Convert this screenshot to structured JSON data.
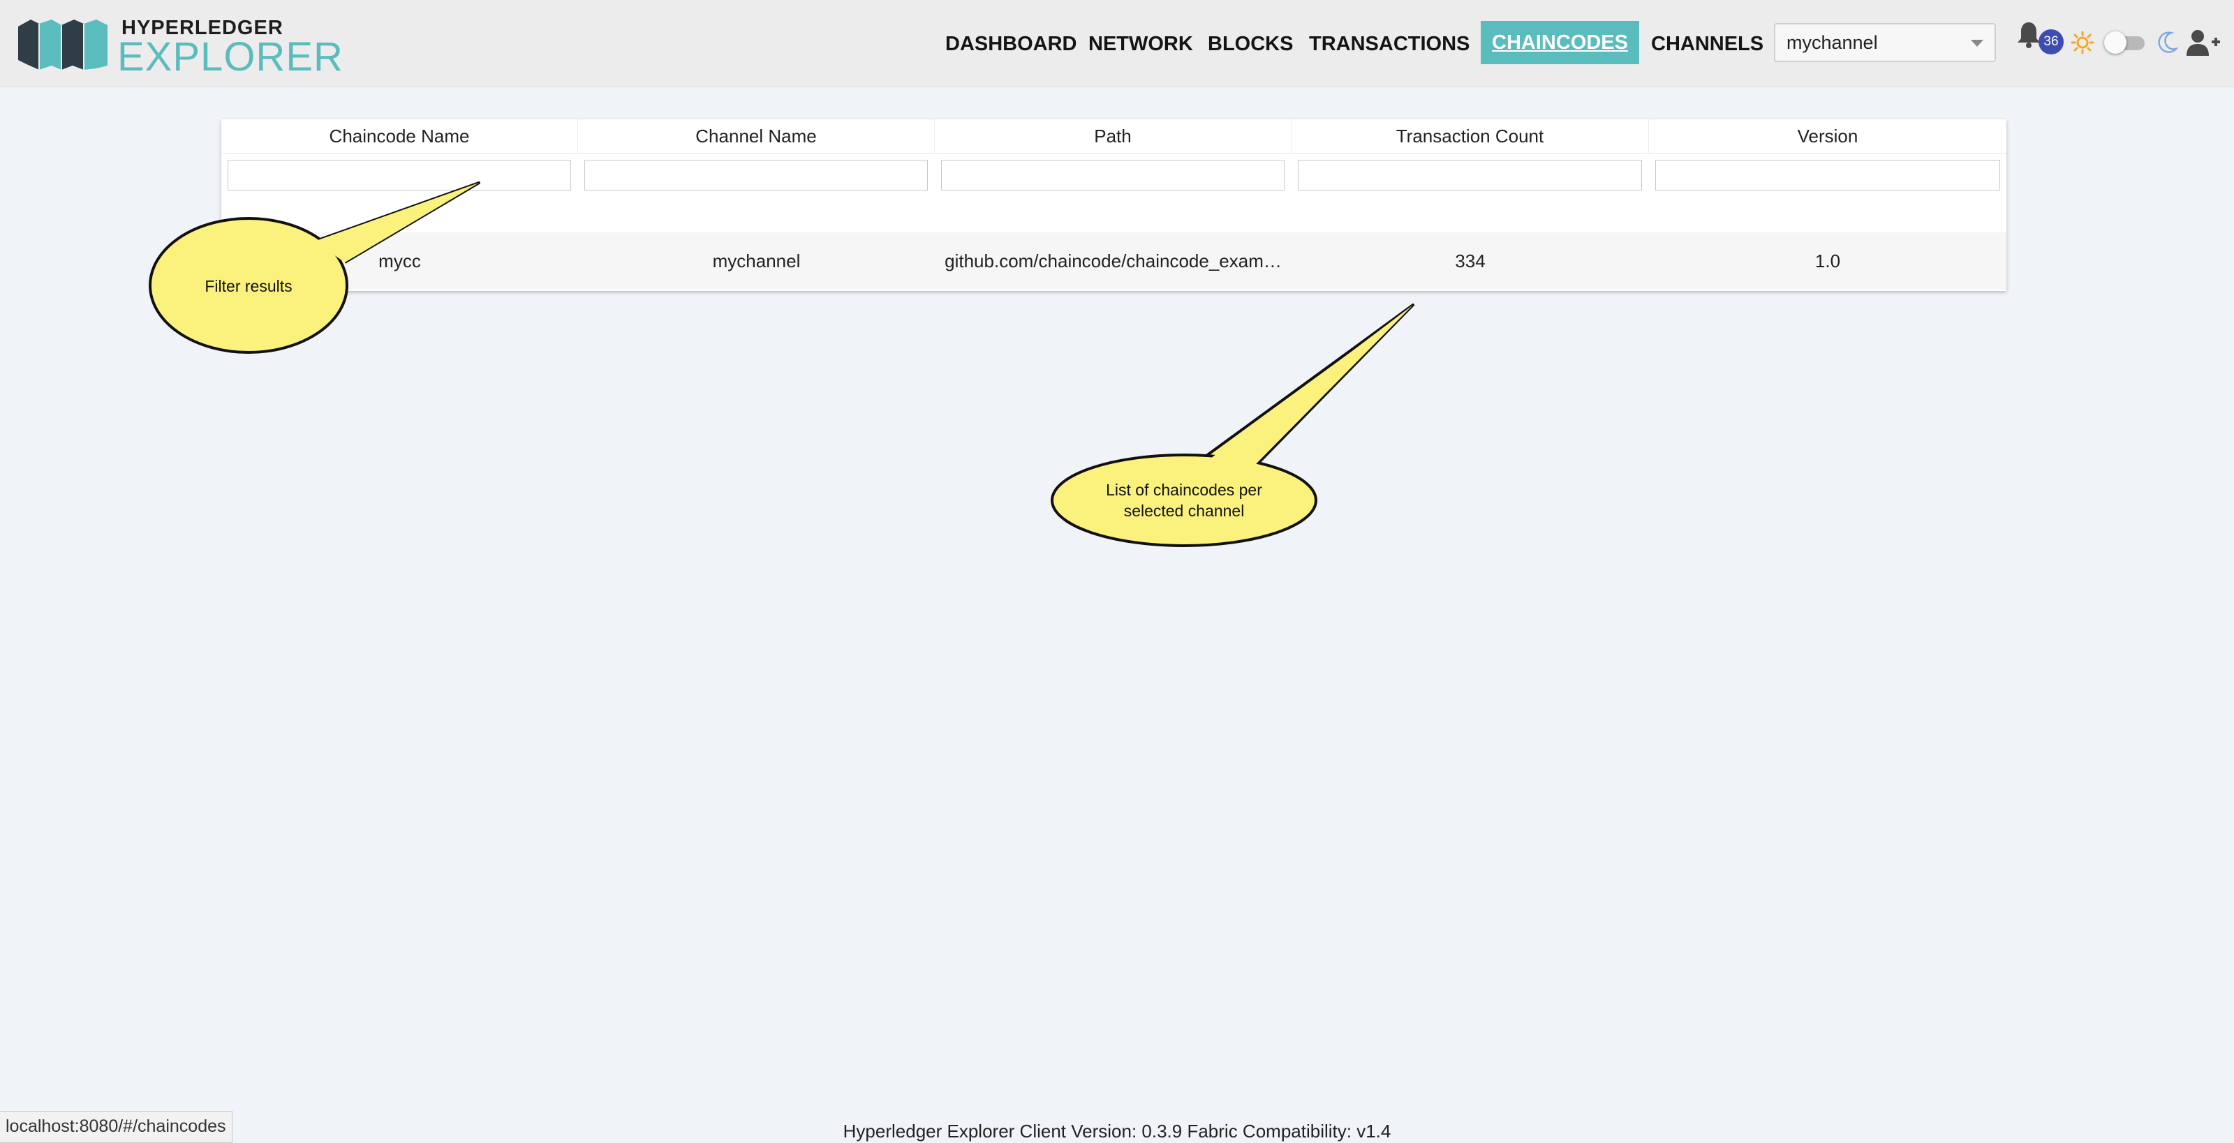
{
  "brand": {
    "top": "HYPERLEDGER",
    "bottom": "EXPLORER"
  },
  "nav": {
    "items": [
      {
        "label": "DASHBOARD"
      },
      {
        "label": "NETWORK"
      },
      {
        "label": "BLOCKS"
      },
      {
        "label": "TRANSACTIONS"
      },
      {
        "label": "CHAINCODES",
        "active": true
      },
      {
        "label": "CHANNELS"
      }
    ],
    "channel_select": {
      "value": "mychannel"
    },
    "notifications_count": "36",
    "icons": [
      "bell-icon",
      "sun-icon",
      "theme-toggle",
      "moon-icon",
      "user-add-icon"
    ],
    "accent_color": "#5bbcbe"
  },
  "table": {
    "columns": [
      "Chaincode Name",
      "Channel Name",
      "Path",
      "Transaction Count",
      "Version"
    ],
    "rows": [
      [
        "mycc",
        "mychannel",
        "github.com/chaincode/chaincode_exam…",
        "334",
        "1.0"
      ]
    ]
  },
  "callouts": {
    "filter": "Filter results",
    "list_line1": "List of chaincodes per",
    "list_line2": "selected channel"
  },
  "footer": {
    "version_text": "Hyperledger Explorer Client Version: 0.3.9   Fabric Compatibility: v1.4",
    "status_url": "localhost:8080/#/chaincodes"
  }
}
